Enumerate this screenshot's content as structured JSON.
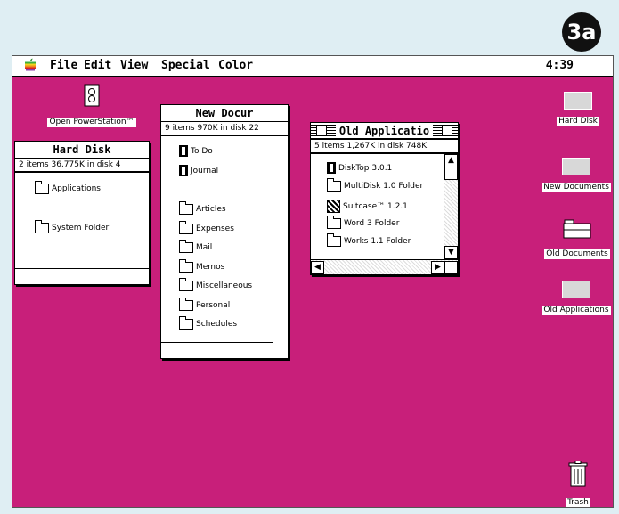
{
  "badge": "3a",
  "menubar": {
    "items": [
      "File",
      "Edit",
      "View",
      "Special",
      "Color"
    ],
    "clock": "4:39"
  },
  "desktop_icons": {
    "open_powerstation": "Open PowerStation™",
    "hard_disk": "Hard Disk",
    "new_documents": "New Documents",
    "old_documents": "Old Documents",
    "old_applications": "Old Applications",
    "trash": "Trash"
  },
  "win_hard_disk": {
    "title": "Hard Disk",
    "info": "2 items  36,775K in disk  4",
    "items": [
      "Applications",
      "System Folder"
    ]
  },
  "win_new_docs": {
    "title": "New Docur",
    "info": "9 items  970K in disk  22",
    "items": [
      "To Do",
      "Journal",
      "Articles",
      "Expenses",
      "Mail",
      "Memos",
      "Miscellaneous",
      "Personal",
      "Schedules"
    ]
  },
  "win_old_apps": {
    "title": "Old Applicatio",
    "info": "5 items  1,267K in disk  748K",
    "items": [
      "DiskTop 3.0.1",
      "MultiDisk 1.0 Folder",
      "Suitcase™ 1.2.1",
      "Word 3 Folder",
      "Works 1.1 Folder"
    ]
  },
  "colors": {
    "desktop": "#c81f7a",
    "page": "#dfeef3"
  }
}
